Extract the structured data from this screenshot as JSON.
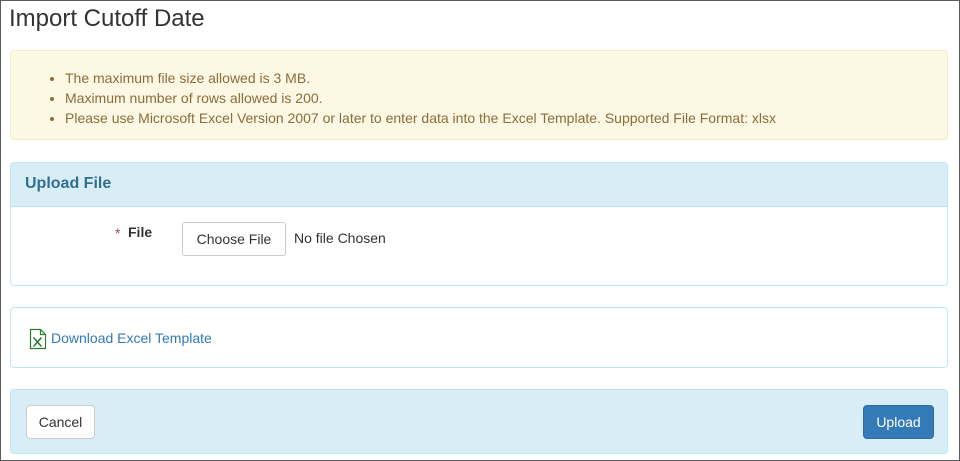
{
  "page": {
    "title": "Import Cutoff Date"
  },
  "notice": {
    "items": [
      "The maximum file size allowed is 3 MB.",
      "Maximum number of rows allowed is 200.",
      "Please use Microsoft Excel Version 2007 or later to enter data into the Excel Template. Supported File Format: xlsx"
    ]
  },
  "upload_panel": {
    "heading": "Upload File",
    "required_marker": "*",
    "file_label": "File",
    "choose_button": "Choose File",
    "file_status": "No file Chosen"
  },
  "download_panel": {
    "icon": "excel-file-icon",
    "link_text": "Download Excel Template"
  },
  "footer": {
    "cancel_label": "Cancel",
    "upload_label": "Upload"
  },
  "colors": {
    "notice_background": "#fcf8e3",
    "notice_text": "#8a6d3b",
    "panel_heading_background": "#d9edf7",
    "panel_heading_text": "#31708f",
    "link": "#337ab7",
    "primary_button": "#337ab7",
    "required": "#a94442"
  }
}
